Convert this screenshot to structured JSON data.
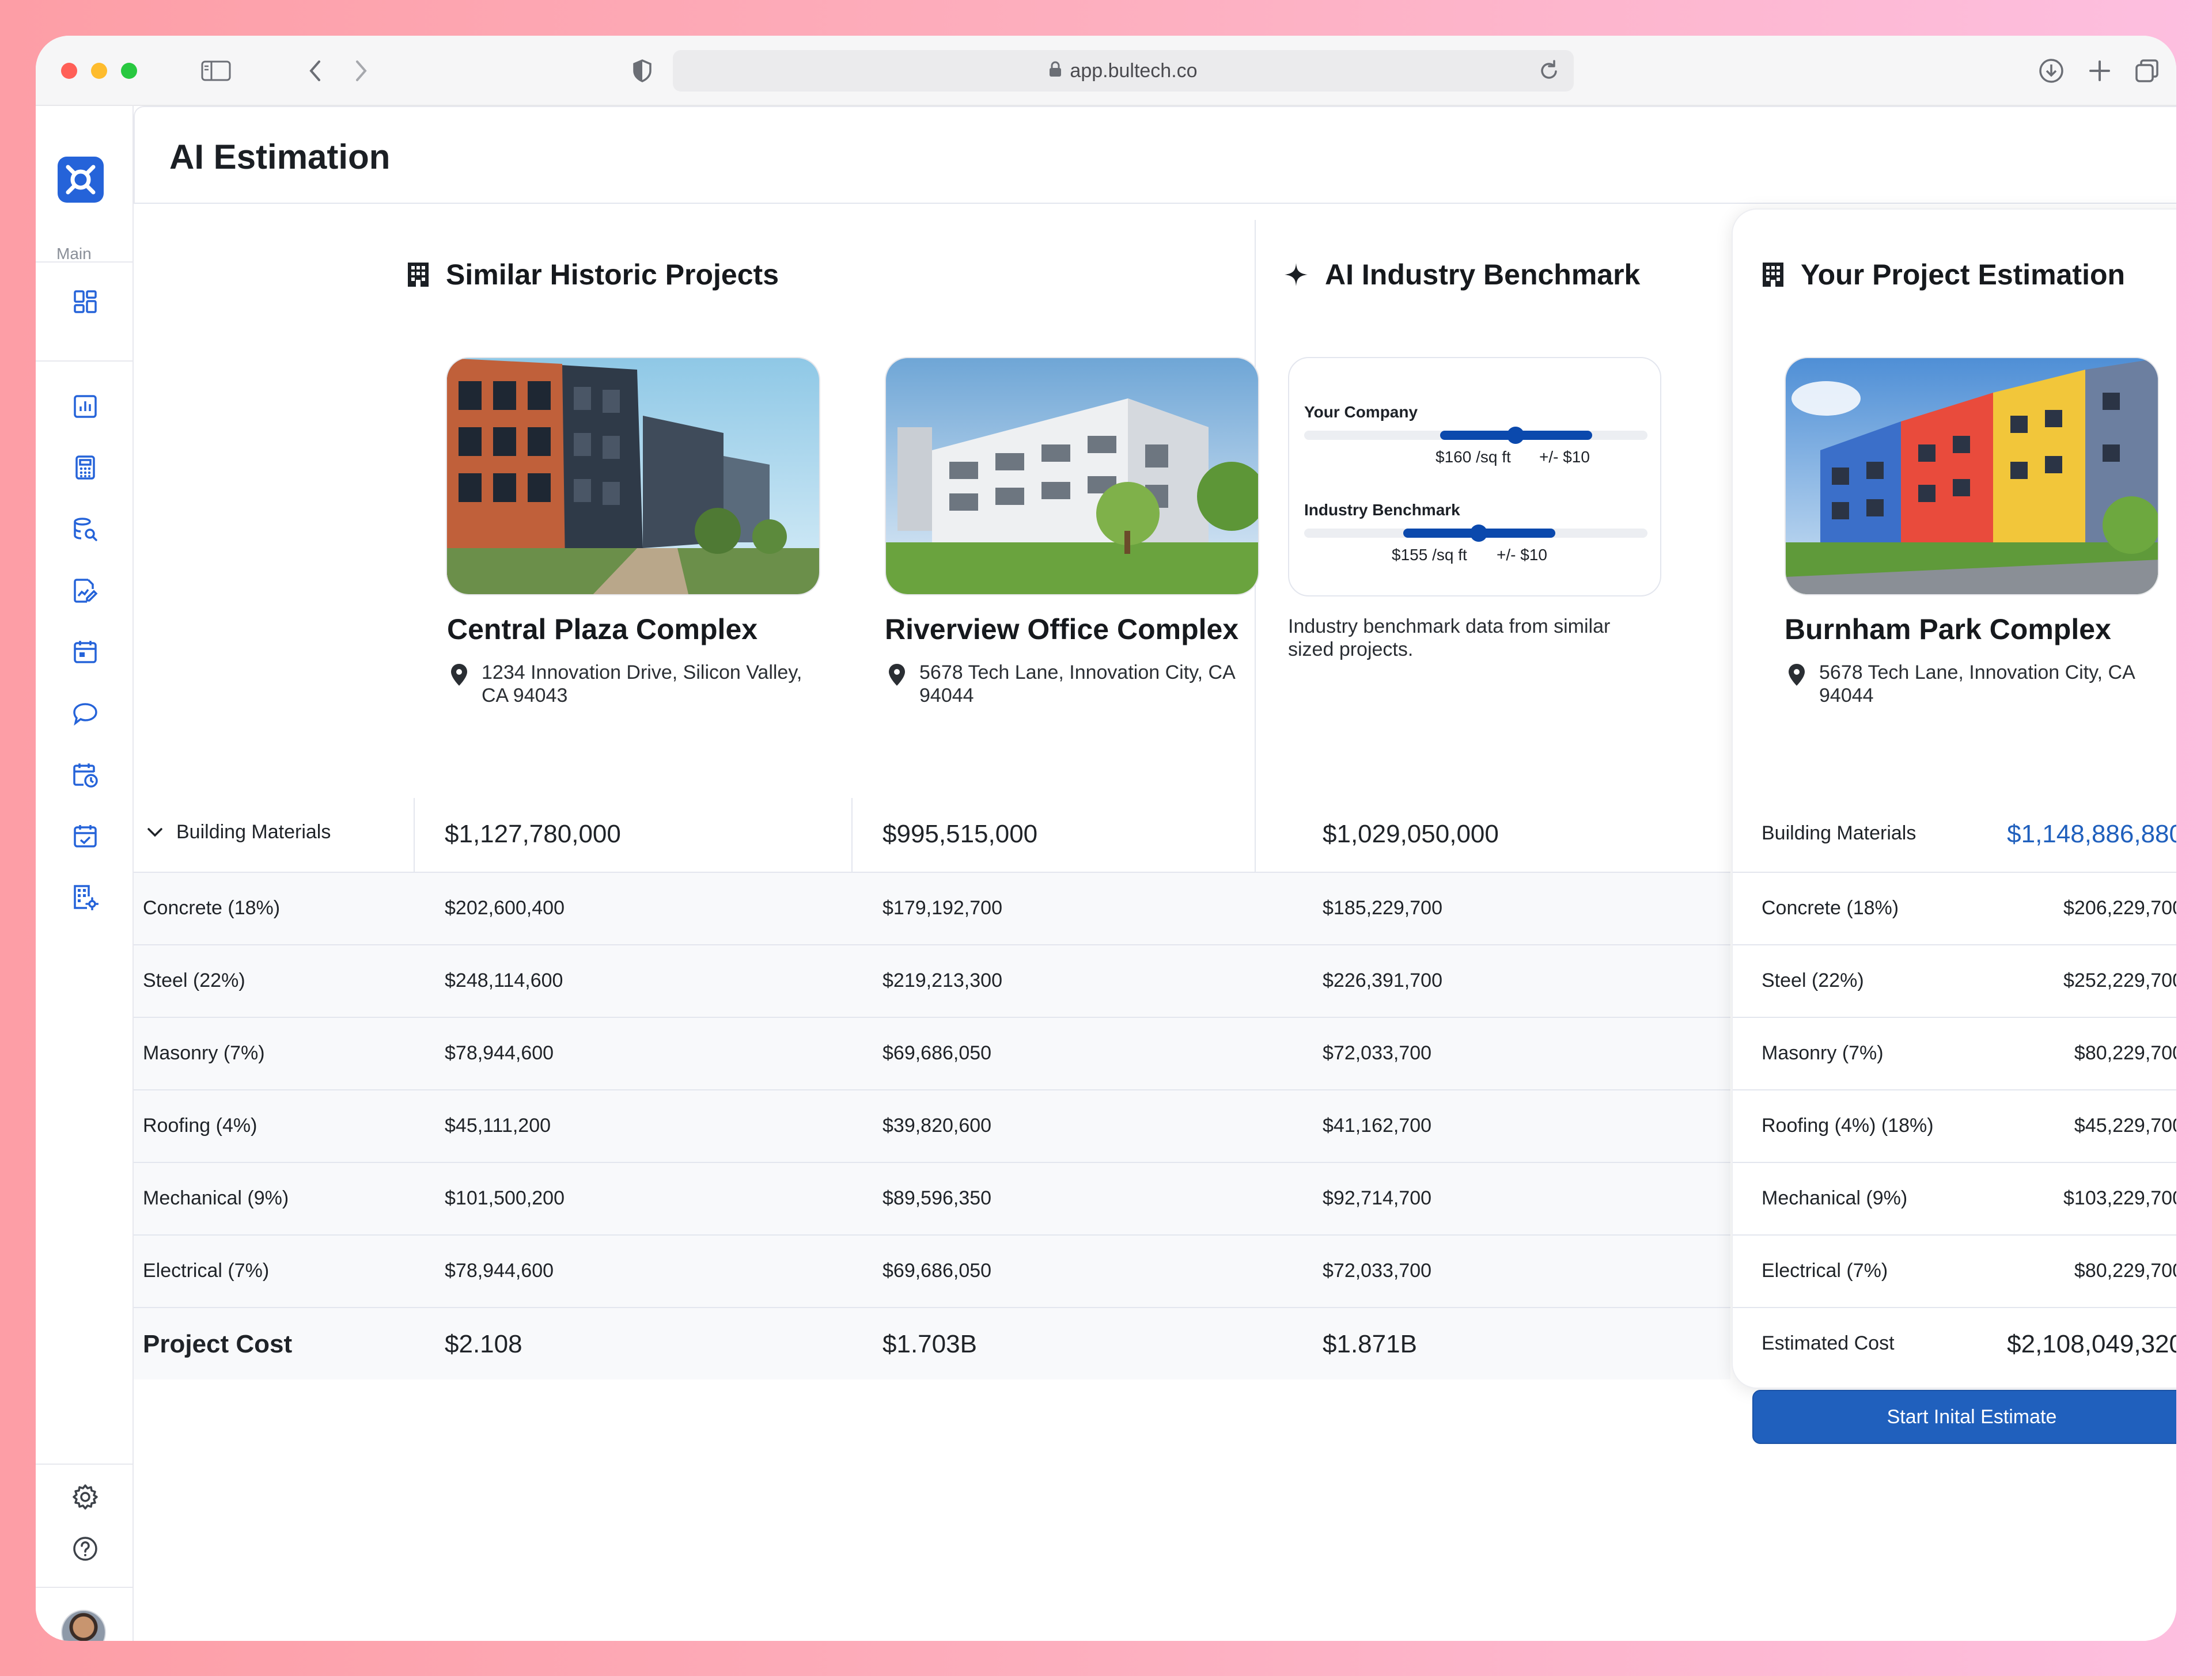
{
  "browser": {
    "url": "app.bultech.co",
    "traffic_lights": {
      "close": "#ff5f57",
      "minimize": "#febc2e",
      "zoom": "#28c840"
    }
  },
  "sidebar": {
    "section_label": "Main",
    "items": [
      {
        "icon": "dashboard-icon"
      },
      {
        "icon": "chart-icon"
      },
      {
        "icon": "calculator-icon"
      },
      {
        "icon": "database-search-icon"
      },
      {
        "icon": "document-chart-icon"
      },
      {
        "icon": "calendar-icon"
      },
      {
        "icon": "chat-bubble-icon"
      },
      {
        "icon": "calendar-clock-icon"
      },
      {
        "icon": "calendar-check-icon"
      },
      {
        "icon": "building-settings-icon"
      }
    ],
    "footer": [
      {
        "icon": "settings-icon"
      },
      {
        "icon": "help-icon"
      }
    ],
    "accent": "#2563d9"
  },
  "page": {
    "title": "AI Estimation"
  },
  "columns": {
    "historic_title": "Similar Historic Projects",
    "benchmark_title": "AI Industry Benchmark",
    "estimate_title": "Your Project Estimation"
  },
  "projects": [
    {
      "name": "Central Plaza Complex",
      "address_line1": "1234 Innovation Drive, Silicon Valley,",
      "address_line2": "CA 94043"
    },
    {
      "name": "Riverview Office Complex",
      "address_line1": "5678 Tech Lane, Innovation City, CA",
      "address_line2": "94044"
    }
  ],
  "benchmark": {
    "your_company": {
      "label": "Your Company",
      "value": "$160 /sq ft",
      "range": "+/- $10",
      "position": 0.62
    },
    "industry": {
      "label": "Industry Benchmark",
      "value": "$155 /sq ft",
      "range": "+/- $10",
      "position": 0.5
    },
    "note": "Industry benchmark data from similar sized projects."
  },
  "estimate": {
    "name": "Burnham Park Complex",
    "address_line1": "5678 Tech Lane, Innovation City, CA",
    "address_line2": "94044",
    "total_label": "Building Materials",
    "total_value": "$1,148,886,880",
    "rows": [
      {
        "label": "Concrete (18%)",
        "value": "$206,229,700"
      },
      {
        "label": "Steel (22%)",
        "value": "$252,229,700"
      },
      {
        "label": "Masonry (7%)",
        "value": "$80,229,700"
      },
      {
        "label": "Roofing (4%) (18%)",
        "value": "$45,229,700"
      },
      {
        "label": "Mechanical (9%)",
        "value": "$103,229,700"
      },
      {
        "label": "Electrical (7%)",
        "value": "$80,229,700"
      }
    ],
    "cost_label": "Estimated Cost",
    "cost_value": "$2,108,049,320",
    "button": "Start Inital Estimate",
    "accent": "#2060bd"
  },
  "table": {
    "header_label": "Building Materials",
    "header_values": [
      "$1,127,780,000",
      "$995,515,000",
      "$1,029,050,000"
    ],
    "rows": [
      {
        "label": "Concrete (18%)",
        "values": [
          "$202,600,400",
          "$179,192,700",
          "$185,229,700"
        ]
      },
      {
        "label": "Steel (22%)",
        "values": [
          "$248,114,600",
          "$219,213,300",
          "$226,391,700"
        ]
      },
      {
        "label": "Masonry (7%)",
        "values": [
          "$78,944,600",
          "$69,686,050",
          "$72,033,700"
        ]
      },
      {
        "label": "Roofing (4%)",
        "values": [
          "$45,111,200",
          "$39,820,600",
          "$41,162,700"
        ]
      },
      {
        "label": "Mechanical (9%)",
        "values": [
          "$101,500,200",
          "$89,596,350",
          "$92,714,700"
        ]
      },
      {
        "label": "Electrical (7%)",
        "values": [
          "$78,944,600",
          "$69,686,050",
          "$72,033,700"
        ]
      }
    ],
    "footer_label": "Project Cost",
    "footer_values": [
      "$2.108",
      "$1.703B",
      "$1.871B"
    ]
  }
}
